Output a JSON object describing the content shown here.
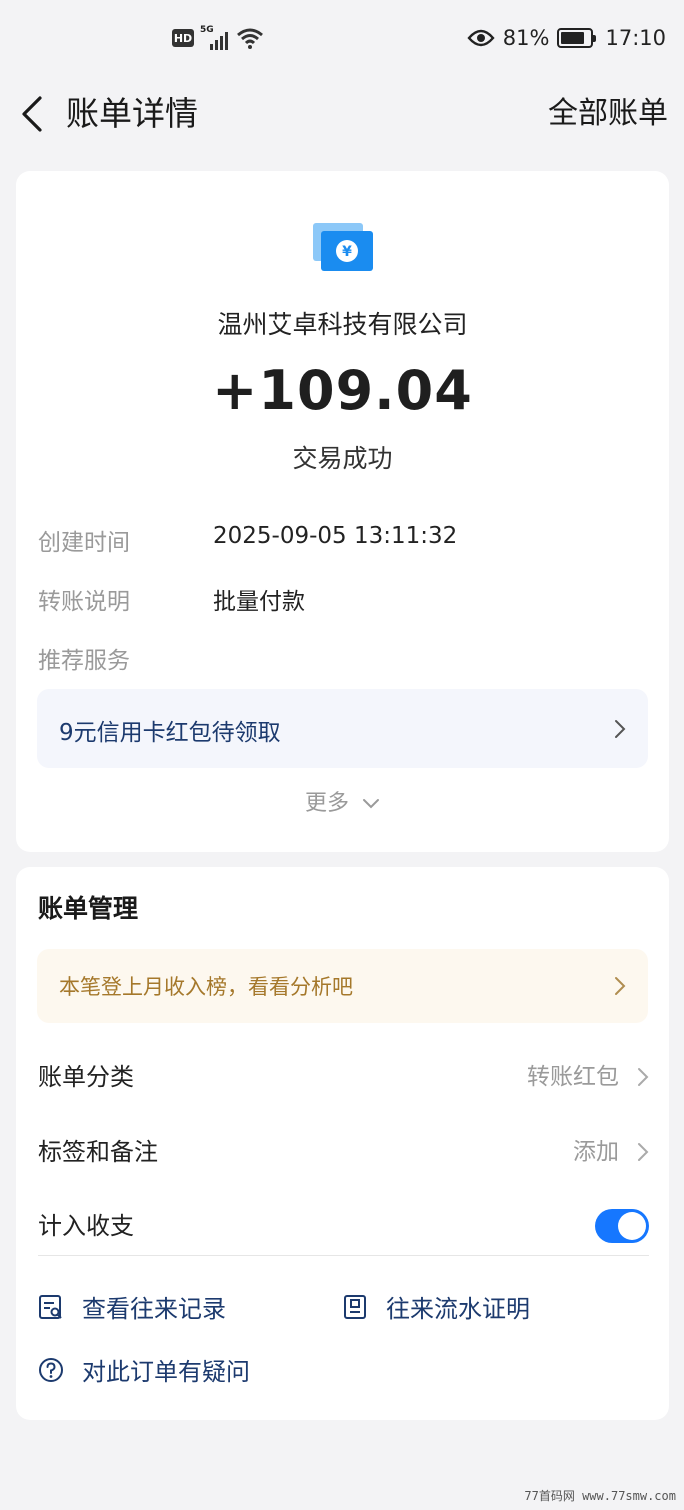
{
  "status_bar": {
    "hd": "HD",
    "network": "5G",
    "battery": "81%",
    "time": "17:10"
  },
  "nav": {
    "title": "账单详情",
    "all_bills": "全部账单"
  },
  "transaction": {
    "merchant": "温州艾卓科技有限公司",
    "amount": "+109.04",
    "status": "交易成功",
    "details": [
      {
        "label": "创建时间",
        "value": "2025-09-05 13:11:32"
      },
      {
        "label": "转账说明",
        "value": "批量付款"
      },
      {
        "label": "推荐服务",
        "value": ""
      }
    ],
    "promo": "9元信用卡红包待领取",
    "more": "更多"
  },
  "management": {
    "title": "账单管理",
    "insight": "本笔登上月收入榜，看看分析吧",
    "category_label": "账单分类",
    "category_value": "转账红包",
    "tags_label": "标签和备注",
    "tags_value": "添加",
    "count_label": "计入收支",
    "count_enabled": true,
    "link_records": "查看往来记录",
    "link_proof": "往来流水证明",
    "link_question": "对此订单有疑问"
  },
  "watermark": "77首码网 www.77smw.com",
  "colors": {
    "accent": "#1677ff",
    "link": "#1c3a6e",
    "insight_text": "#a5782b",
    "icon_blue": "#1a8cf0"
  }
}
